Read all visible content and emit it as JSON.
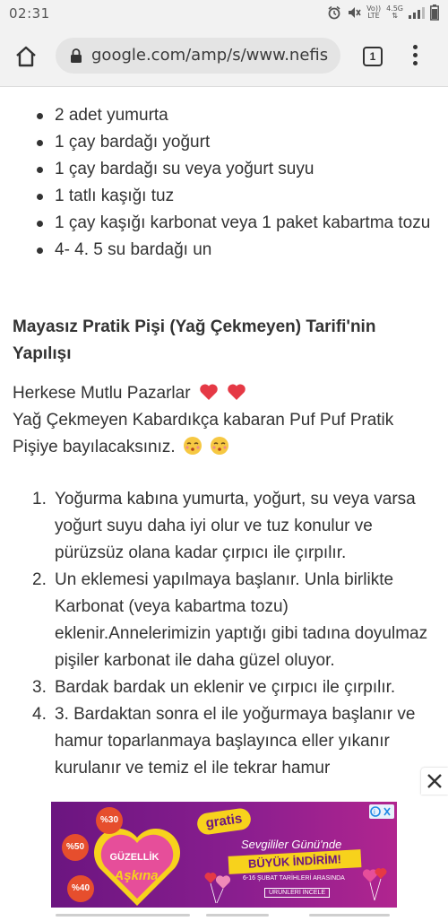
{
  "status_bar": {
    "time": "02:31",
    "network_top": "Vo))",
    "network_bottom": "LTE",
    "signal_label": "4.5G"
  },
  "browser": {
    "url": "google.com/amp/s/www.nefis",
    "tab_count": "1"
  },
  "ingredients": [
    "2 adet yumurta",
    "1 çay bardağı yoğurt",
    "1 çay bardağı su veya yoğurt suyu",
    "1 tatlı kaşığı tuz",
    "1 çay kaşığı karbonat veya 1 paket kabartma tozu",
    "4- 4. 5 su bardağı un"
  ],
  "section_heading": "Mayasız Pratik Pişi (Yağ Çekmeyen) Tarifi'nin Yapılışı",
  "intro": {
    "line1": "Herkese Mutlu Pazarlar",
    "line2": "Yağ Çekmeyen Kabardıkça kabaran Puf Puf Pratik Pişiye bayılacaksınız."
  },
  "steps": [
    {
      "num": "1.",
      "text": "Yoğurma kabına yumurta, yoğurt, su veya varsa yoğurt suyu daha iyi olur ve tuz konulur ve pürüzsüz olana kadar çırpıcı ile çırpılır."
    },
    {
      "num": "2.",
      "text": "Un eklemesi yapılmaya başlanır. Unla birlikte Karbonat (veya kabartma tozu) eklenir.Annelerimizin yaptığı gibi tadına doyulmaz pişiler karbonat ile daha güzel oluyor."
    },
    {
      "num": "3.",
      "text": "Bardak bardak un eklenir ve çırpıcı ile çırpılır."
    },
    {
      "num": "4.",
      "text": "3. Bardaktan sonra el ile yoğurmaya başlanır ve hamur toparlanmaya başlayınca eller yıkanır kurulanır ve temiz el ile tekrar hamur"
    }
  ],
  "ad": {
    "brand": "gratis",
    "left_title": "GÜZELLİK",
    "left_sub": "Aşkına",
    "badge_top": "%30",
    "badge_mid": "%50",
    "badge_low": "%40",
    "headline": "Sevgililer Günü'nde",
    "promo": "BÜYÜK İNDİRİM!",
    "dates": "6-16 ŞUBAT TARİHLERİ ARASINDA",
    "button": "ÜRÜNLERİ İNCELE",
    "close_label": "✕"
  },
  "colors": {
    "ad_purple": "#6b1580",
    "ad_yellow": "#f7d21c",
    "heart_red": "#e53945"
  }
}
